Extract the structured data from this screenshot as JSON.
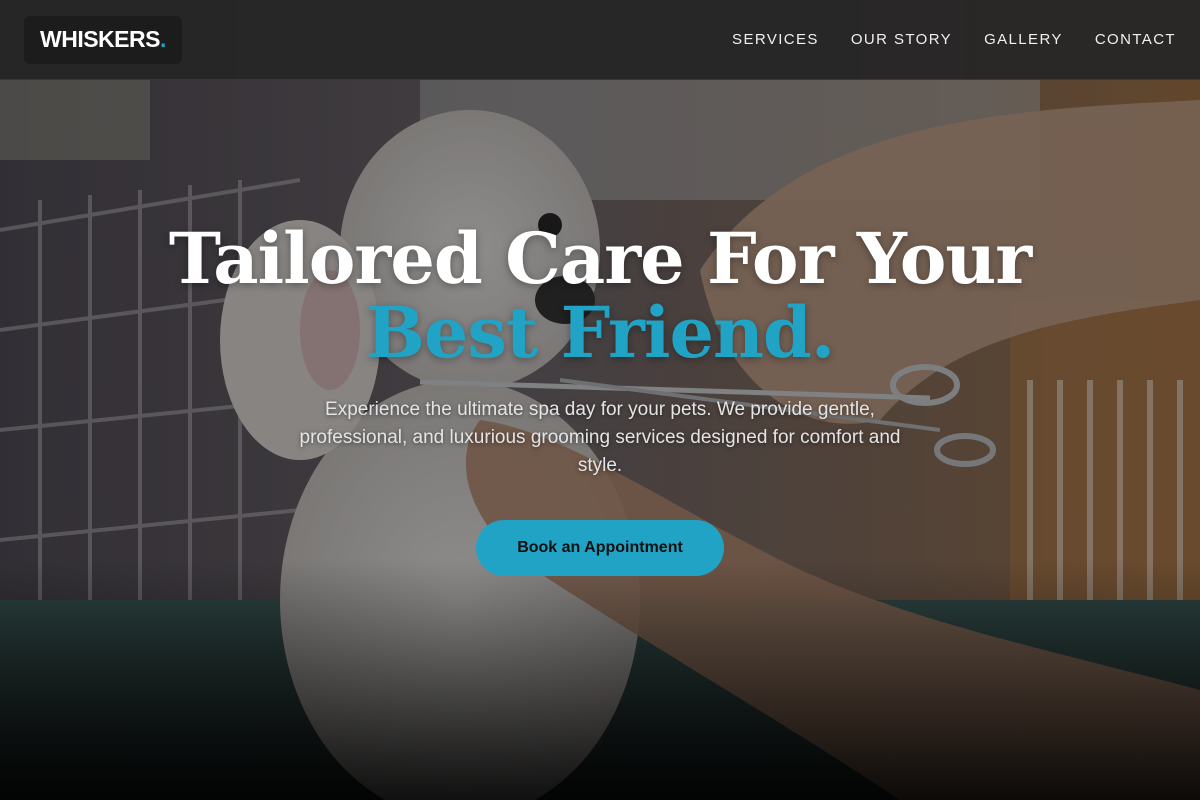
{
  "header": {
    "logo_text": "WHISKERS",
    "logo_dot": ".",
    "nav": [
      {
        "label": "SERVICES"
      },
      {
        "label": "OUR STORY"
      },
      {
        "label": "GALLERY"
      },
      {
        "label": "CONTACT"
      }
    ]
  },
  "hero": {
    "title_line1": "Tailored Care For Your",
    "title_line2": "Best Friend.",
    "subtitle": "Experience the ultimate spa day for your pets. We provide gentle, professional, and luxurious grooming services designed for comfort and style.",
    "cta_label": "Book an Appointment",
    "background_description_icon": "dog-grooming-photo"
  },
  "colors": {
    "accent": "#20a3c5",
    "header_bg": "#262626",
    "text": "#ffffff"
  }
}
